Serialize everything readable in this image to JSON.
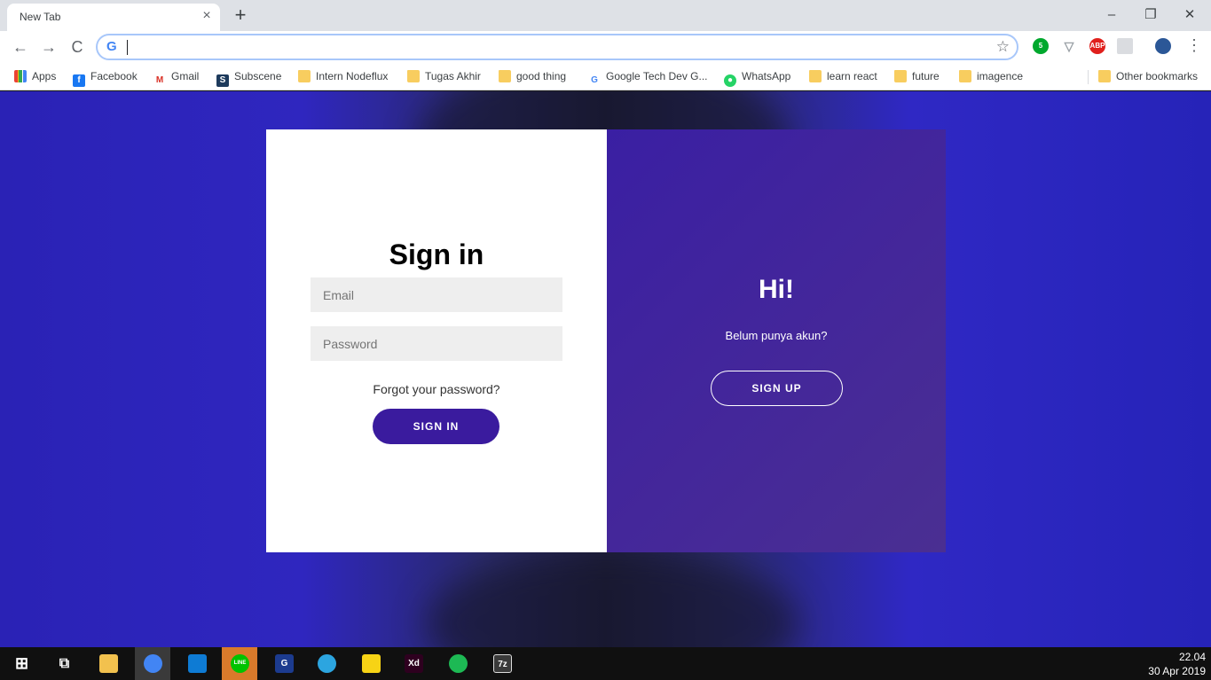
{
  "browser": {
    "tab_title": "New Tab",
    "tab_close": "×",
    "new_tab": "+",
    "window_controls": {
      "minimize": "–",
      "restore": "❐",
      "close": "✕"
    },
    "address_value": "",
    "menu": "⋮",
    "extensions": [
      {
        "name": "evernote-icon",
        "label": "5",
        "color": "#00a82d"
      },
      {
        "name": "shield-icon",
        "label": "▽",
        "color": "#9aa0a6"
      },
      {
        "name": "adblock-plus-icon",
        "label": "ABP",
        "color": "#e0201c"
      },
      {
        "name": "extension-icon",
        "label": "",
        "color": "#dadce0"
      },
      {
        "name": "profile-avatar-icon",
        "label": "",
        "color": "#2b5797"
      }
    ]
  },
  "bookmarks": [
    {
      "label": "Apps",
      "icon": "apps-grid-icon"
    },
    {
      "label": "Facebook",
      "icon": "facebook-icon"
    },
    {
      "label": "Gmail",
      "icon": "gmail-icon"
    },
    {
      "label": "Subscene",
      "icon": "subscene-icon"
    },
    {
      "label": "Intern Nodeflux",
      "icon": "folder-icon"
    },
    {
      "label": "Tugas Akhir",
      "icon": "folder-icon"
    },
    {
      "label": "good thing",
      "icon": "folder-icon"
    },
    {
      "label": "Google Tech Dev G...",
      "icon": "google-icon"
    },
    {
      "label": "WhatsApp",
      "icon": "whatsapp-icon"
    },
    {
      "label": "learn react",
      "icon": "folder-icon"
    },
    {
      "label": "future",
      "icon": "folder-icon"
    },
    {
      "label": "imagence",
      "icon": "folder-icon"
    }
  ],
  "other_bookmarks": "Other bookmarks",
  "signin": {
    "title": "Sign in",
    "email_placeholder": "Email",
    "password_placeholder": "Password",
    "forgot": "Forgot your password?",
    "button": "SIGN IN"
  },
  "overlay": {
    "title": "Hi!",
    "subtitle": "Belum punya akun?",
    "button": "SIGN UP"
  },
  "taskbar": {
    "time": "22.04",
    "date": "30 Apr 2019",
    "items": [
      {
        "name": "windows-start-icon",
        "label": "",
        "color": "transparent"
      },
      {
        "name": "task-view-icon",
        "label": "",
        "color": "transparent"
      },
      {
        "name": "file-explorer-icon",
        "label": "",
        "color": "#f2c14e"
      },
      {
        "name": "chrome-icon",
        "label": "",
        "color": "#4285f4"
      },
      {
        "name": "vscode-icon",
        "label": "",
        "color": "#0e7bd4"
      },
      {
        "name": "line-icon",
        "label": "LINE",
        "color": "#00c300"
      },
      {
        "name": "pdf-reader-icon",
        "label": "G",
        "color": "#1c3b8f"
      },
      {
        "name": "telegram-icon",
        "label": "",
        "color": "#2ca5e0"
      },
      {
        "name": "sticky-notes-icon",
        "label": "",
        "color": "#f7d315"
      },
      {
        "name": "adobe-xd-icon",
        "label": "Xd",
        "color": "#2e001f"
      },
      {
        "name": "spotify-icon",
        "label": "",
        "color": "#1db954"
      },
      {
        "name": "7zip-icon",
        "label": "7z",
        "color": "#3a3a3a"
      }
    ]
  }
}
